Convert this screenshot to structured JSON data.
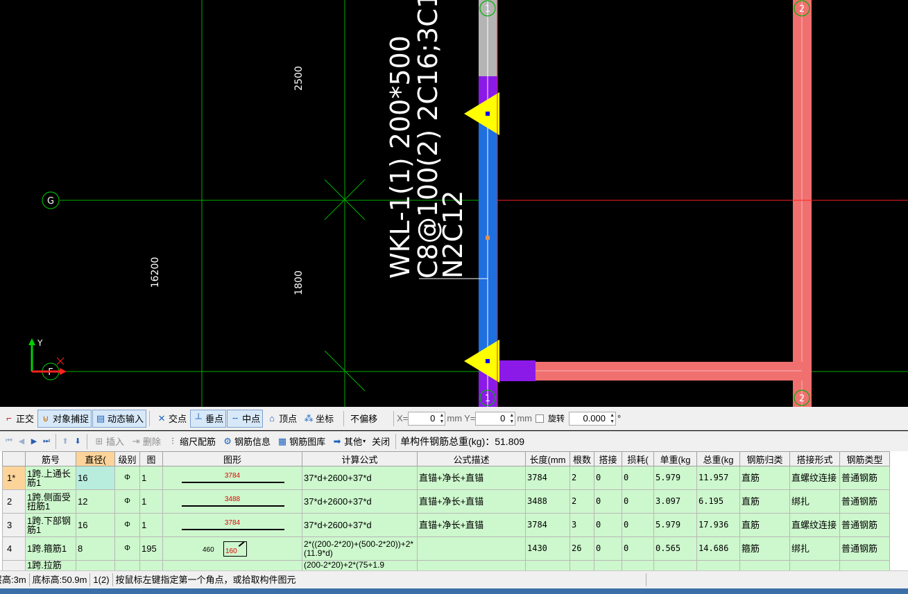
{
  "cad": {
    "beam_label_lines": [
      "WKL-1(1) 200*500",
      "C8@100(2) 2C16;3C1",
      "N2C12"
    ],
    "dims": {
      "d2500": "2500",
      "d1800": "1800",
      "d16200": "16200"
    },
    "axes": {
      "top_1": "1",
      "top_2": "2",
      "left_G": "G",
      "left_F": "F",
      "bot_1": "1",
      "bot_2": "2"
    },
    "ucs": {
      "y": "Y"
    },
    "colors": {
      "background": "#000000",
      "beam_selected": "#1e6fe0",
      "beam_other": "#f07070",
      "column": "#8b1ae8",
      "grid": "#00c000",
      "crosshair": "#ff0000",
      "marker": "#ffff00"
    }
  },
  "toolbar1": {
    "ortho": "正交",
    "snap": "对象捕捉",
    "dyn_input": "动态输入",
    "intersection": "交点",
    "perpendicular": "垂点",
    "midpoint": "中点",
    "vertex": "顶点",
    "coords": "坐标",
    "offset_mode": "不偏移",
    "x_label": "X=",
    "x_value": "0",
    "x_unit": "mm",
    "y_label": "Y=",
    "y_value": "0",
    "y_unit": "mm",
    "rotate_label": "旋转",
    "rotate_value": "0.000",
    "rotate_unit": "°"
  },
  "toolbar2": {
    "insert": "插入",
    "delete": "删除",
    "scale_rebar": "缩尺配筋",
    "rebar_info": "钢筋信息",
    "rebar_lib": "钢筋图库",
    "other": "其他",
    "close": "关闭",
    "total_weight": "单构件钢筋总重(kg)：51.809"
  },
  "table": {
    "headers": [
      "",
      "筋号",
      "直径(",
      "级别",
      "图",
      "图形",
      "计算公式",
      "公式描述",
      "长度(mm",
      "根数",
      "搭接",
      "损耗(",
      "单重(kg",
      "总重(kg",
      "钢筋归类",
      "搭接形式",
      "钢筋类型"
    ],
    "rows": [
      {
        "no": "1*",
        "name": "1跨.上通长筋1",
        "dia": "16",
        "grade": "Φ",
        "fig": "1",
        "shape": "3784",
        "formula": "37*d+2600+37*d",
        "desc": "直锚+净长+直锚",
        "len": "3784",
        "count": "2",
        "lap": "0",
        "loss": "0",
        "unit_w": "5.979",
        "total_w": "11.957",
        "cls": "直筋",
        "lap_form": "直螺纹连接",
        "type": "普通钢筋"
      },
      {
        "no": "2",
        "name": "1跨.侧面受扭筋1",
        "dia": "12",
        "grade": "Φ",
        "fig": "1",
        "shape": "3488",
        "formula": "37*d+2600+37*d",
        "desc": "直锚+净长+直锚",
        "len": "3488",
        "count": "2",
        "lap": "0",
        "loss": "0",
        "unit_w": "3.097",
        "total_w": "6.195",
        "cls": "直筋",
        "lap_form": "绑扎",
        "type": "普通钢筋"
      },
      {
        "no": "3",
        "name": "1跨.下部钢筋1",
        "dia": "16",
        "grade": "Φ",
        "fig": "1",
        "shape": "3784",
        "formula": "37*d+2600+37*d",
        "desc": "直锚+净长+直锚",
        "len": "3784",
        "count": "3",
        "lap": "0",
        "loss": "0",
        "unit_w": "5.979",
        "total_w": "17.936",
        "cls": "直筋",
        "lap_form": "直螺纹连接",
        "type": "普通钢筋"
      },
      {
        "no": "4",
        "name": "1跨.箍筋1",
        "dia": "8",
        "grade": "Φ",
        "fig": "195",
        "shape_a": "460",
        "shape_b": "160",
        "formula": "2*((200-2*20)+(500-2*20))+2*(11.9*d)",
        "desc": "",
        "len": "1430",
        "count": "26",
        "lap": "0",
        "loss": "0",
        "unit_w": "0.565",
        "total_w": "14.686",
        "cls": "箍筋",
        "lap_form": "绑扎",
        "type": "普通钢筋"
      },
      {
        "no": "",
        "name": "1跨.拉筋",
        "formula": "(200-2*20)+2*(75+1.9",
        "shape": ""
      }
    ]
  },
  "status": {
    "floor_height": "层高:3m",
    "base_height": "底标高:50.9m",
    "count": "1(2)",
    "prompt": "按鼠标左键指定第一个角点，或拾取构件图元"
  }
}
